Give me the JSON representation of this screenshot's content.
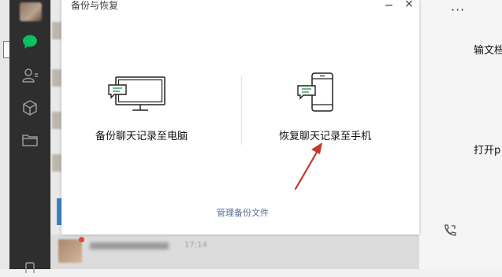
{
  "dialog": {
    "title": "备份与恢复",
    "backup_to_pc_label": "备份聊天记录至电脑",
    "restore_to_phone_label": "恢复聊天记录至手机",
    "manage_backup_link": "管理备份文件",
    "min_icon": "minimize-icon",
    "close_icon": "close-icon",
    "close_glyph": "×"
  },
  "sidebar": {
    "icons": [
      "chat-icon",
      "contacts-icon",
      "favorites-cube-icon",
      "folder-icon",
      "phone-icon"
    ],
    "active_color": "#07c160"
  },
  "chat_panel": {
    "more_glyph": "···",
    "text_1": "输文档",
    "text_2": "打开p",
    "call_icon": "voice-call-icon"
  },
  "bottom_item": {
    "time": "17:14"
  },
  "annotation": {
    "arrow_color": "#c0392b"
  }
}
